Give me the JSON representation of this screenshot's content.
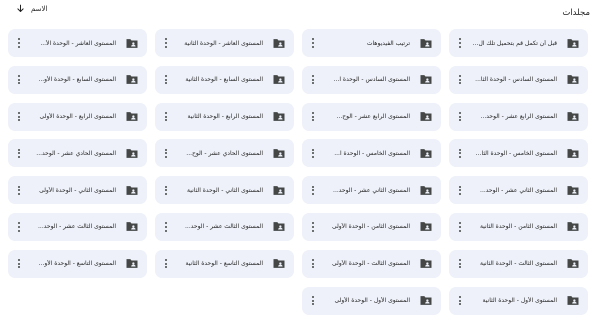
{
  "section": {
    "title": "مجلدات"
  },
  "sort": {
    "label": "الاسم",
    "icon": "arrow-down-icon"
  },
  "folders": [
    {
      "name": "قبل أن تكمل قم بتحميل تلك ال..."
    },
    {
      "name": "ترتيب الفيديوهات"
    },
    {
      "name": "المستوى العاشر - الوحدة الثانية"
    },
    {
      "name": "المستوى العاشر - الوحدة الأ..."
    },
    {
      "name": "المستوى السادس - الوحدة الثا..."
    },
    {
      "name": "المستوى السادس - الوحدة ا..."
    },
    {
      "name": "المستوى السابع - الوحدة الثانية"
    },
    {
      "name": "المستوى السابع - الوحدة الأو..."
    },
    {
      "name": "المستوى الرابع عشر - الوحد..."
    },
    {
      "name": "المستوى الرابع عشر - الوح..."
    },
    {
      "name": "المستوى الرابع - الوحدة الثانية"
    },
    {
      "name": "المستوى الرابع - الوحدة الأولى"
    },
    {
      "name": "المستوى الخامس - الوحدة الثا..."
    },
    {
      "name": "المستوى الخامس - الوحدة ا..."
    },
    {
      "name": "المستوى الحادي عشر - الوح..."
    },
    {
      "name": "المستوى الحادي عشر - الوحد..."
    },
    {
      "name": "المستوى الثاني عشر - الوحد..."
    },
    {
      "name": "المستوى الثاني عشر - الوحد..."
    },
    {
      "name": "المستوى الثاني - الوحدة الثانية"
    },
    {
      "name": "المستوى الثاني - الوحدة الأولى"
    },
    {
      "name": "المستوى الثامن - الوحدة الثانية"
    },
    {
      "name": "المستوى الثامن - الوحدة الأولى"
    },
    {
      "name": "المستوى الثالث عشر - الوحد..."
    },
    {
      "name": "المستوى الثالث عشر - الوحد..."
    },
    {
      "name": "المستوى الثالث - الوحدة الثانية"
    },
    {
      "name": "المستوى الثالث - الوحدة الأولى"
    },
    {
      "name": "المستوى التاسع - الوحدة الثانية"
    },
    {
      "name": "المستوى التاسع - الوحدة الأو..."
    },
    {
      "name": "المستوى الأول - الوحدة الثانية"
    },
    {
      "name": "المستوى الأول - الوحدة الأولى"
    }
  ],
  "colors": {
    "card_bg": "#eef1f9",
    "icon": "#444746",
    "text": "#1f1f1f"
  }
}
